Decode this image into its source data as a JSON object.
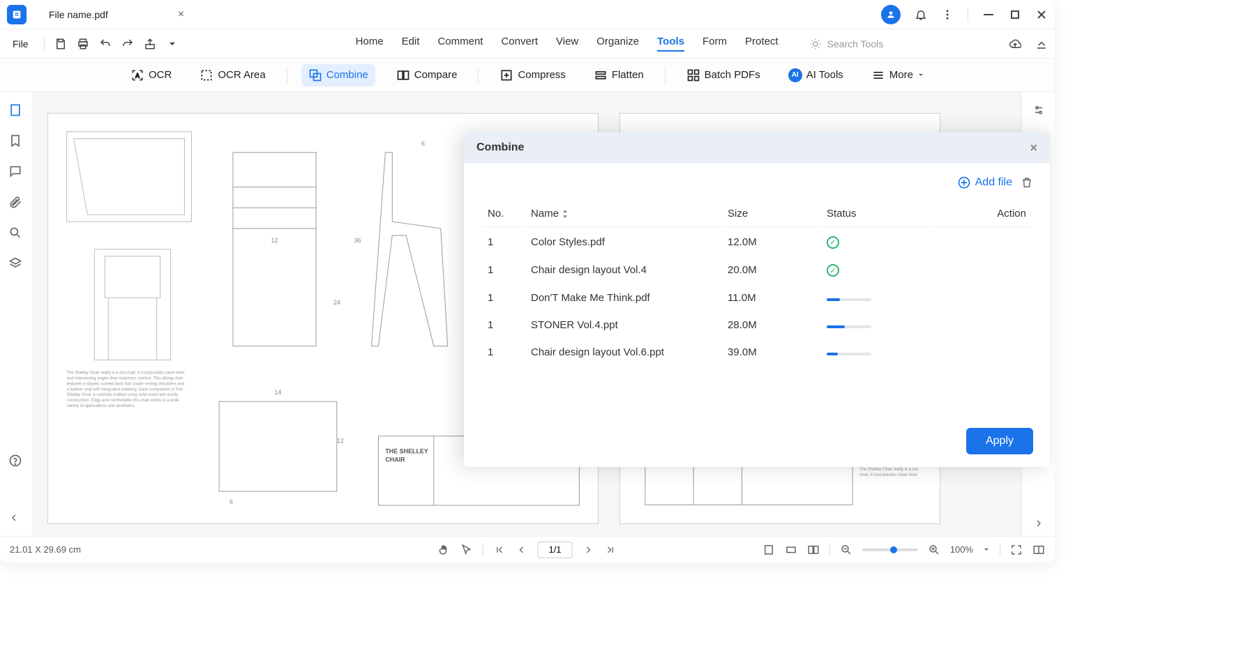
{
  "tab": {
    "filename": "File name.pdf"
  },
  "menubar": {
    "file": "File"
  },
  "mainMenu": {
    "items": [
      "Home",
      "Edit",
      "Comment",
      "Convert",
      "View",
      "Organize",
      "Tools",
      "Form",
      "Protect"
    ],
    "activeIndex": 6
  },
  "search": {
    "placeholder": "Search Tools"
  },
  "toolbar": {
    "ocr": "OCR",
    "ocrArea": "OCR Area",
    "combine": "Combine",
    "compare": "Compare",
    "compress": "Compress",
    "flatten": "Flatten",
    "batch": "Batch PDFs",
    "ai": "AI Tools",
    "more": "More"
  },
  "combinePanel": {
    "title": "Combine",
    "addFile": "Add file",
    "columns": {
      "no": "No.",
      "name": "Name",
      "size": "Size",
      "status": "Status",
      "action": "Action"
    },
    "rows": [
      {
        "no": "1",
        "name": "Color Styles.pdf",
        "size": "12.0M",
        "status": "done"
      },
      {
        "no": "1",
        "name": "Chair design layout Vol.4",
        "size": "20.0M",
        "status": "done"
      },
      {
        "no": "1",
        "name": "Don'T Make Me Think.pdf",
        "size": "11.0M",
        "status": "progress",
        "progress": "p30"
      },
      {
        "no": "1",
        "name": "STONER Vol.4.ppt",
        "size": "28.0M",
        "status": "progress",
        "progress": "p40"
      },
      {
        "no": "1",
        "name": "Chair design layout Vol.6.ppt",
        "size": "39.0M",
        "status": "progress",
        "progress": "p25"
      }
    ],
    "apply": "Apply"
  },
  "statusbar": {
    "dimensions": "21.01 X 29.69 cm",
    "pageIndicator": "1/1",
    "zoom": "100%"
  }
}
